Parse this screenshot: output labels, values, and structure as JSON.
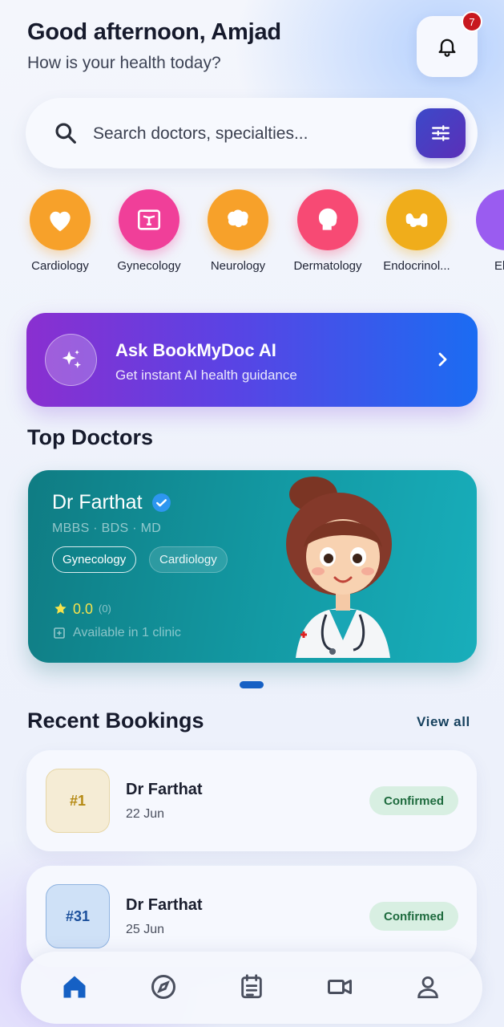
{
  "header": {
    "greeting": "Good afternoon, Amjad",
    "subtitle": "How is your health today?",
    "notification_count": "7"
  },
  "search": {
    "placeholder": "Search doctors, specialties..."
  },
  "categories": [
    {
      "label": "Cardiology",
      "color": "#f7a12a",
      "icon": "heart-icon"
    },
    {
      "label": "Gynecology",
      "color": "#f03f99",
      "icon": "uterus-icon"
    },
    {
      "label": "Neurology",
      "color": "#f7a12a",
      "icon": "brain-icon"
    },
    {
      "label": "Dermatology",
      "color": "#f74a74",
      "icon": "face-icon"
    },
    {
      "label": "Endocrinol...",
      "color": "#f0ad1b",
      "icon": "gland-icon"
    },
    {
      "label": "El",
      "color": "#9a5cf0",
      "icon": "category-icon"
    }
  ],
  "ai_banner": {
    "title": "Ask BookMyDoc AI",
    "subtitle": "Get instant AI health guidance"
  },
  "top_doctors": {
    "heading": "Top Doctors",
    "doctor": {
      "name": "Dr Farthat",
      "degrees": "MBBS · BDS · MD",
      "specialties": [
        "Gynecology",
        "Cardiology"
      ],
      "rating": "0.0",
      "reviews": "(0)",
      "availability": "Available in 1 clinic"
    }
  },
  "recent_bookings": {
    "heading": "Recent Bookings",
    "view_all": "View all",
    "items": [
      {
        "number": "#1",
        "doctor": "Dr Farthat",
        "date": "22 Jun",
        "status": "Confirmed"
      },
      {
        "number": "#31",
        "doctor": "Dr Farthat",
        "date": "25 Jun",
        "status": "Confirmed"
      }
    ]
  },
  "bottom_nav": [
    {
      "name": "home",
      "icon": "home-icon",
      "active": true
    },
    {
      "name": "explore",
      "icon": "compass-icon",
      "active": false
    },
    {
      "name": "appointments",
      "icon": "calendar-list-icon",
      "active": false
    },
    {
      "name": "video",
      "icon": "video-icon",
      "active": false
    },
    {
      "name": "profile",
      "icon": "user-icon",
      "active": false
    }
  ],
  "colors": {
    "accent": "#1560c4",
    "badge": "#c8181f",
    "card_teal": "#139aa4",
    "ai_gradient_start": "#8a2fd0",
    "ai_gradient_end": "#1b6cf2",
    "status_confirmed": "#1e6b3e"
  }
}
